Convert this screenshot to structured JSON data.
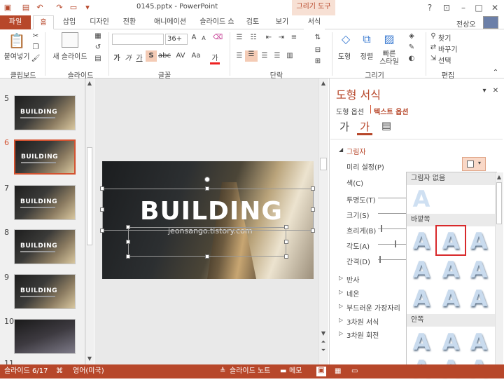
{
  "window": {
    "title": "0145.pptx - PowerPoint",
    "context_tab_group": "그리기 도구",
    "user": "전상오",
    "help": "?"
  },
  "tabs": [
    "파일",
    "홈",
    "삽입",
    "디자인",
    "전환",
    "애니메이션",
    "슬라이드 쇼",
    "검토",
    "보기",
    "서식"
  ],
  "ribbon": {
    "clipboard": {
      "paste": "붙여넣기",
      "label": "클립보드"
    },
    "slides": {
      "new_slide": "새 슬라이드",
      "label": "슬라이드"
    },
    "font": {
      "size": "36+",
      "label": "글꼴",
      "bold": "가",
      "italic": "가",
      "underline": "가",
      "strike": "S",
      "spacing": "AV",
      "case": "Aa",
      "color": "가"
    },
    "paragraph": {
      "label": "단락"
    },
    "drawing": {
      "shape": "도형",
      "arrange": "정렬",
      "quick_styles": "빠른\n스타일",
      "label": "그리기"
    },
    "editing": {
      "find": "찾기",
      "replace": "바꾸기",
      "select": "선택",
      "label": "편집"
    }
  },
  "thumbnails": [
    {
      "num": "5",
      "title": "BUILDING",
      "selected": false
    },
    {
      "num": "6",
      "title": "BUILDING",
      "selected": true
    },
    {
      "num": "7",
      "title": "BUILDING",
      "selected": false
    },
    {
      "num": "8",
      "title": "BUILDING",
      "selected": false
    },
    {
      "num": "9",
      "title": "BUILDING",
      "selected": false
    },
    {
      "num": "10",
      "title": "",
      "selected": false
    },
    {
      "num": "11",
      "title": "",
      "selected": false
    }
  ],
  "slide": {
    "title": "BUILDING",
    "subtitle": "jeonsango.tistory.com"
  },
  "format_pane": {
    "title": "도형 서식",
    "tab_shape_options": "도형 옵션",
    "tab_text_options": "텍스트 옵션",
    "section_shadow": "그림자",
    "preset_label": "미리 설정(P)",
    "color_label": "색(C)",
    "transparency_label": "투명도(T)",
    "size_label": "크기(S)",
    "blur_label": "흐리게(B)",
    "angle_label": "각도(A)",
    "distance_label": "간격(D)",
    "sections": [
      "반사",
      "네온",
      "부드러운 가장자리",
      "3차원 서식",
      "3차원 회전"
    ]
  },
  "shadow_gallery": {
    "none_header": "그림자 없음",
    "outer_header": "바깥쪽",
    "inner_header": "안쪽",
    "glyph": "A"
  },
  "status": {
    "slide_info": "슬라이드 6/17",
    "language": "영어(미국)",
    "notes": "슬라이드 노트",
    "comments": "메모"
  },
  "colors": {
    "accent": "#b7472a",
    "selection": "#d35230",
    "gallery_highlight": "#d8292b"
  }
}
